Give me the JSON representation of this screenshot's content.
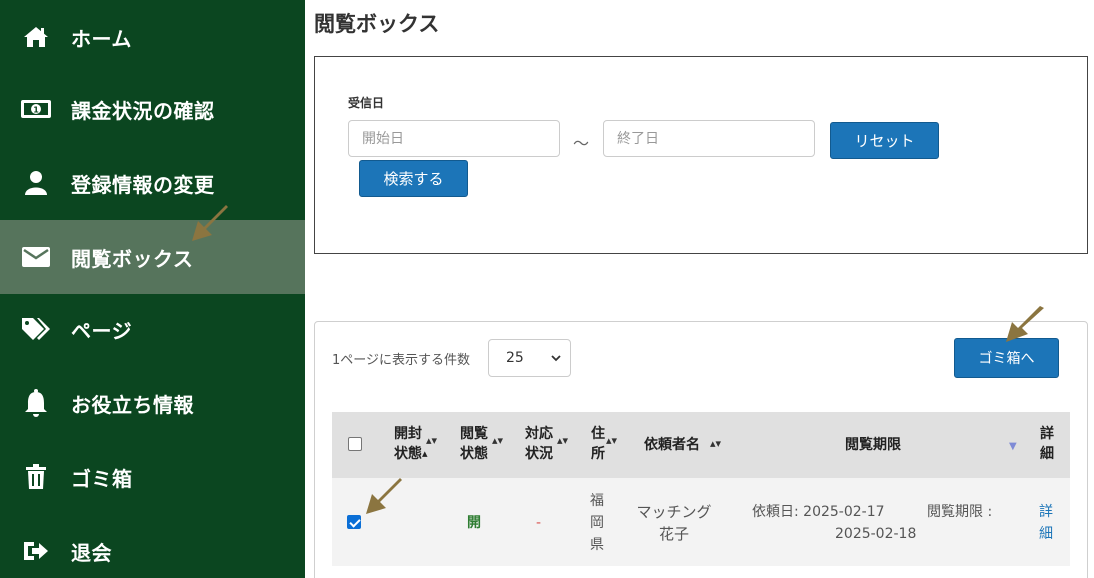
{
  "sidebar": {
    "items": [
      {
        "label": "ホーム",
        "icon": "home-icon"
      },
      {
        "label": "課金状況の確認",
        "icon": "money-icon"
      },
      {
        "label": "登録情報の変更",
        "icon": "user-icon"
      },
      {
        "label": "閲覧ボックス",
        "icon": "envelope-icon",
        "active": true
      },
      {
        "label": "ページ",
        "icon": "tags-icon"
      },
      {
        "label": "お役立ち情報",
        "icon": "bell-icon"
      },
      {
        "label": "ゴミ箱",
        "icon": "trash-icon"
      },
      {
        "label": "退会",
        "icon": "sign-out-icon"
      }
    ]
  },
  "main": {
    "title": "閲覧ボックス",
    "search": {
      "received_date_label": "受信日",
      "start_placeholder": "開始日",
      "separator": "～",
      "end_placeholder": "終了日",
      "reset_label": "リセット",
      "search_label": "検索する"
    },
    "list": {
      "per_page_label": "1ページに表示する件数",
      "per_page_value": "25",
      "trash_button_label": "ゴミ箱へ",
      "headers": {
        "open_status_1": "開封",
        "open_status_2": "状態",
        "view_status_1": "閲覧",
        "view_status_2": "状態",
        "response_status_1": "対応",
        "response_status_2": "状況",
        "address_1": "住",
        "address_2": "所",
        "requester": "依頼者名",
        "view_period": "閲覧期限",
        "detail_1": "詳",
        "detail_2": "細"
      },
      "rows": [
        {
          "checked": true,
          "view_status": "開",
          "response_status": "-",
          "address_1": "福",
          "address_2": "岡",
          "address_3": "県",
          "requester_1": "マッチング",
          "requester_2": "花子",
          "request_date": "依頼日: 2025-02-17",
          "view_period_label": "閲覧期限 :",
          "view_period_date": "2025-02-18",
          "detail_1": "詳",
          "detail_2": "細"
        }
      ]
    }
  },
  "colors": {
    "sidebar_bg": "#0b4620",
    "sidebar_active": "#56745c",
    "button_blue": "#1c75b8",
    "status_open_green": "#2e7d32",
    "status_dash_red": "#d9534f",
    "annotation_arrow": "#8b7540"
  }
}
